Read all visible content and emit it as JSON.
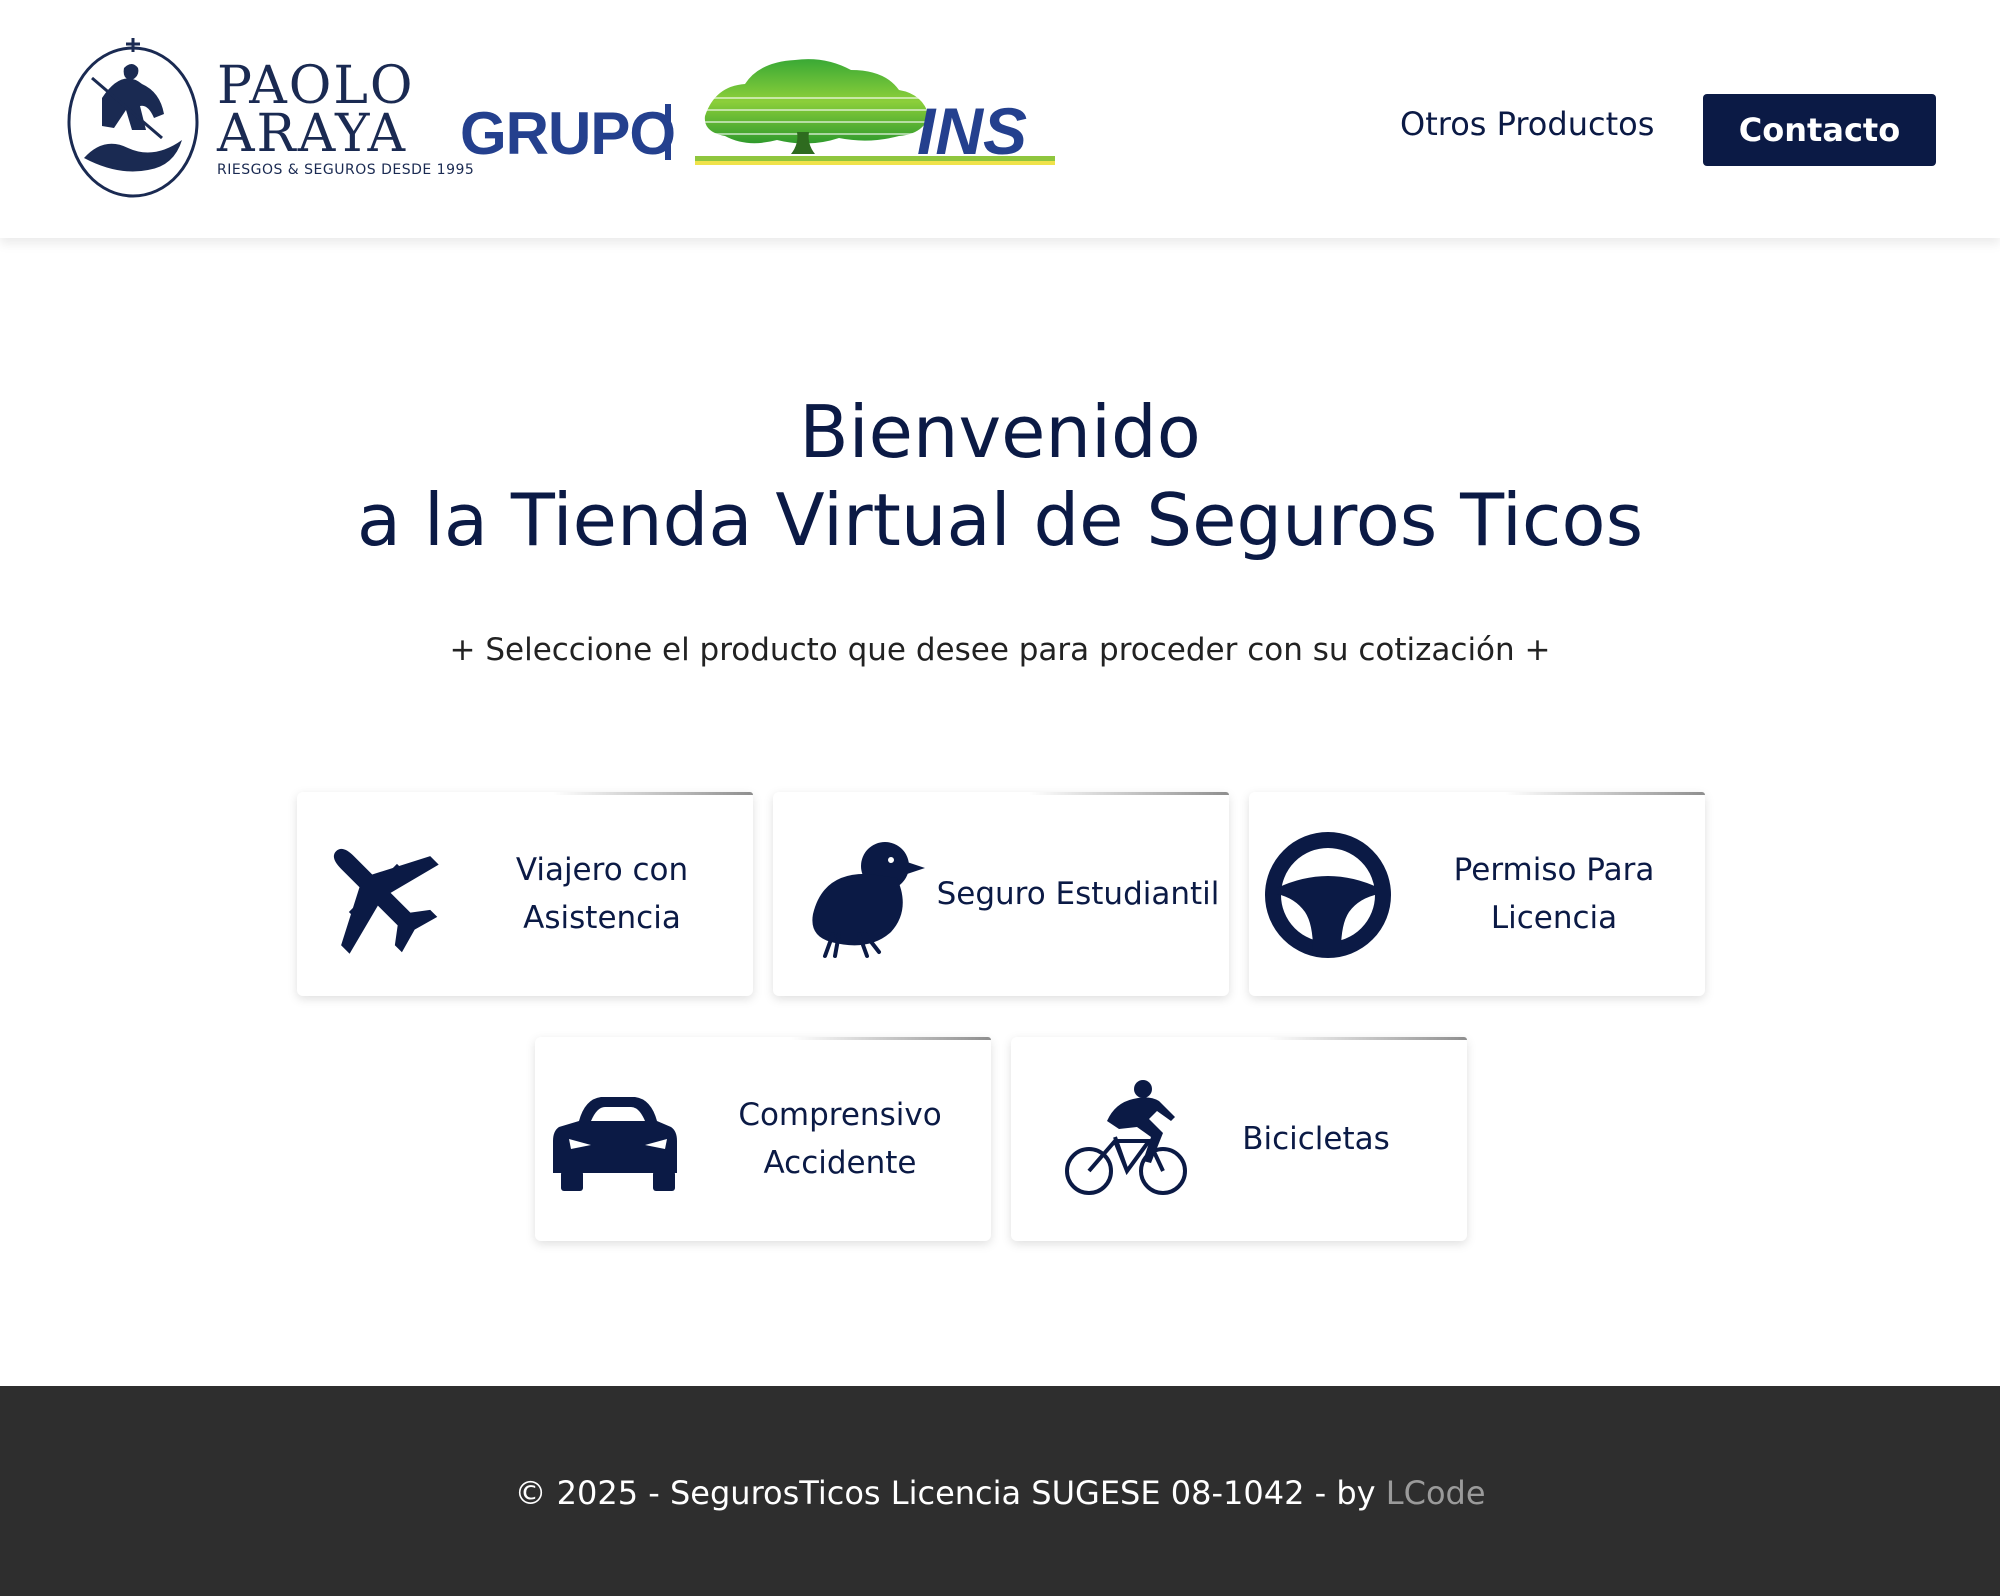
{
  "header": {
    "brand": {
      "line1": "PAOLO",
      "line2": "ARAYA",
      "tagline": "RIESGOS & SEGUROS DESDE 1995"
    },
    "partner": {
      "grupo": "GRUPO",
      "ins": "INS"
    },
    "nav": {
      "otros_productos": "Otros Productos",
      "contacto": "Contacto"
    }
  },
  "main": {
    "title_line1": "Bienvenido",
    "title_line2": "a la Tienda Virtual de Seguros Ticos",
    "subtitle": "+ Seleccione el producto que desee para proceder con su cotización +",
    "products": [
      {
        "label_line1": "Viajero con",
        "label_line2": "Asistencia",
        "icon": "airplane-icon"
      },
      {
        "label_line1": "Seguro Estudiantil",
        "label_line2": "",
        "icon": "chick-icon"
      },
      {
        "label_line1": "Permiso Para",
        "label_line2": "Licencia",
        "icon": "steering-wheel-icon"
      },
      {
        "label_line1": "Comprensivo",
        "label_line2": "Accidente",
        "icon": "car-icon"
      },
      {
        "label_line1": "Bicicletas",
        "label_line2": "",
        "icon": "cyclist-icon"
      }
    ]
  },
  "footer": {
    "text": "© 2025 - SegurosTicos Licencia SUGESE 08-1042 - by ",
    "link": "LCode"
  },
  "colors": {
    "navy": "#0b1a45",
    "footer_bg": "#2e2e2e",
    "footer_link": "#9a9a9a",
    "ins_blue": "#24408e",
    "ins_green": "#3aa935"
  }
}
